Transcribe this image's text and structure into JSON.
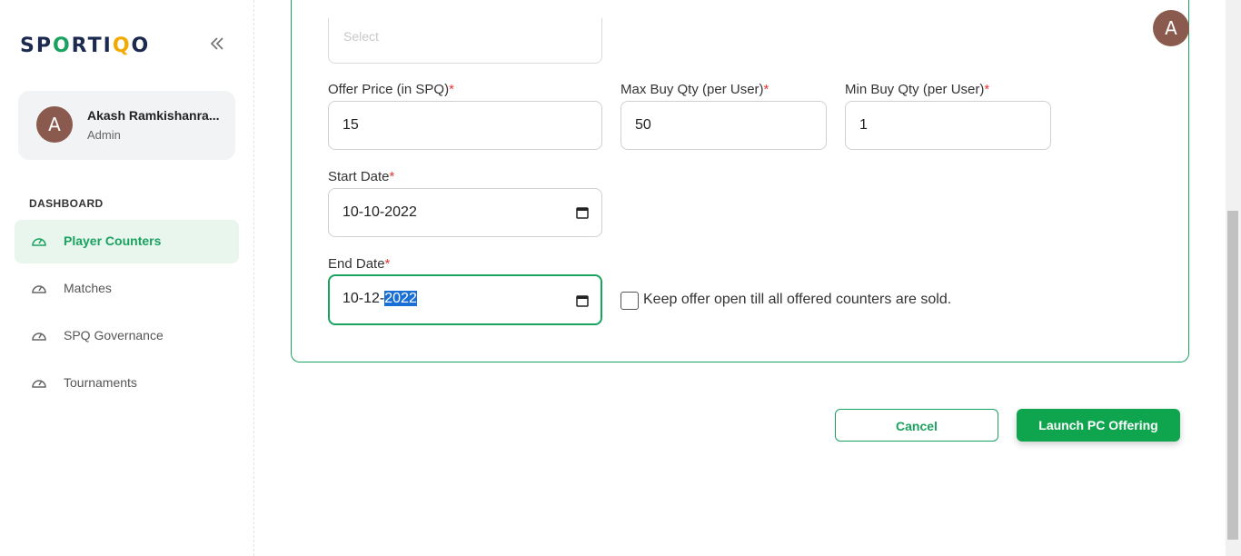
{
  "brand": {
    "logo_text": [
      "SP",
      "O",
      "RTI",
      "Q",
      "O"
    ]
  },
  "sidebar": {
    "user": {
      "initial": "A",
      "name": "Akash Ramkishanra...",
      "role": "Admin"
    },
    "section_label": "DASHBOARD",
    "items": [
      {
        "label": "Player Counters",
        "active": true
      },
      {
        "label": "Matches",
        "active": false
      },
      {
        "label": "SPQ Governance",
        "active": false
      },
      {
        "label": "Tournaments",
        "active": false
      }
    ]
  },
  "header": {
    "avatar_initial": "A"
  },
  "form": {
    "partial_field_value": "Select",
    "offer_price": {
      "label": "Offer Price (in SPQ)",
      "required": "*",
      "value": "15"
    },
    "max_buy": {
      "label": "Max Buy Qty (per User)",
      "required": "*",
      "value": "50"
    },
    "min_buy": {
      "label": "Min Buy Qty (per User)",
      "required": "*",
      "value": "1"
    },
    "start_date": {
      "label": "Start Date",
      "required": "*",
      "value": "10-10-2022"
    },
    "end_date": {
      "label": "End Date",
      "required": "*",
      "value_prefix": "10-12-",
      "value_selected": "2022"
    },
    "keep_open": {
      "label": "Keep offer open till all offered counters are sold.",
      "checked": false
    }
  },
  "actions": {
    "cancel_label": "Cancel",
    "launch_label": "Launch PC Offering"
  },
  "colors": {
    "accent": "#1aa260",
    "required": "#e53935",
    "avatar": "#8a5a4e",
    "selection": "#1a6fd4"
  }
}
